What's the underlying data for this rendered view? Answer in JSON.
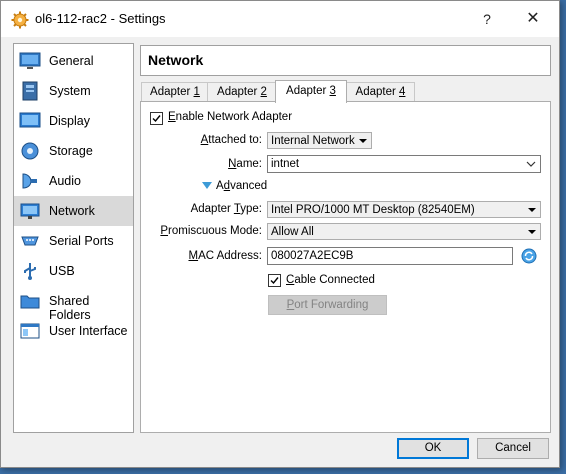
{
  "window": {
    "title": "ol6-112-rac2 - Settings",
    "help": "?",
    "close": "✕"
  },
  "sidebar": {
    "items": [
      {
        "label": "General",
        "icon": "general-icon"
      },
      {
        "label": "System",
        "icon": "system-icon"
      },
      {
        "label": "Display",
        "icon": "display-icon"
      },
      {
        "label": "Storage",
        "icon": "storage-icon"
      },
      {
        "label": "Audio",
        "icon": "audio-icon"
      },
      {
        "label": "Network",
        "icon": "network-icon",
        "selected": true
      },
      {
        "label": "Serial Ports",
        "icon": "serial-ports-icon"
      },
      {
        "label": "USB",
        "icon": "usb-icon"
      },
      {
        "label": "Shared Folders",
        "icon": "shared-folders-icon"
      },
      {
        "label": "User Interface",
        "icon": "user-interface-icon"
      }
    ]
  },
  "header": {
    "title": "Network"
  },
  "tabs": [
    {
      "label": "Adapter ",
      "mnemonic": "1"
    },
    {
      "label": "Adapter ",
      "mnemonic": "2"
    },
    {
      "label": "Adapter ",
      "mnemonic": "3",
      "selected": true
    },
    {
      "label": "Adapter ",
      "mnemonic": "4"
    }
  ],
  "form": {
    "enable_adapter": {
      "mnemonic": "E",
      "rest": "nable Network Adapter",
      "checked": true
    },
    "attached_to": {
      "mnemonic": "A",
      "rest": "ttached to:",
      "value": "Internal Network"
    },
    "name": {
      "mnemonic": "N",
      "rest": "ame:",
      "value": "intnet"
    },
    "advanced": {
      "mnemonic": "d",
      "before": "A",
      "rest": "vanced",
      "expanded": true
    },
    "adapter_type": {
      "before": "Adapter ",
      "mnemonic": "T",
      "rest": "ype:",
      "value": "Intel PRO/1000 MT Desktop (82540EM)"
    },
    "promiscuous_mode": {
      "mnemonic": "P",
      "rest": "romiscuous Mode:",
      "value": "Allow All"
    },
    "mac_address": {
      "mnemonic": "M",
      "rest": "AC Address:",
      "value": "080027A2EC9B"
    },
    "cable_connected": {
      "mnemonic": "C",
      "rest": "able Connected",
      "checked": true
    },
    "port_forwarding": {
      "mnemonic": "P",
      "rest": "ort Forwarding",
      "enabled": false
    }
  },
  "buttons": {
    "ok": "OK",
    "cancel": "Cancel"
  },
  "colors": {
    "accent": "#0078d7",
    "selected_bg": "#d9d9d9",
    "expander": "#3d9bd7"
  }
}
